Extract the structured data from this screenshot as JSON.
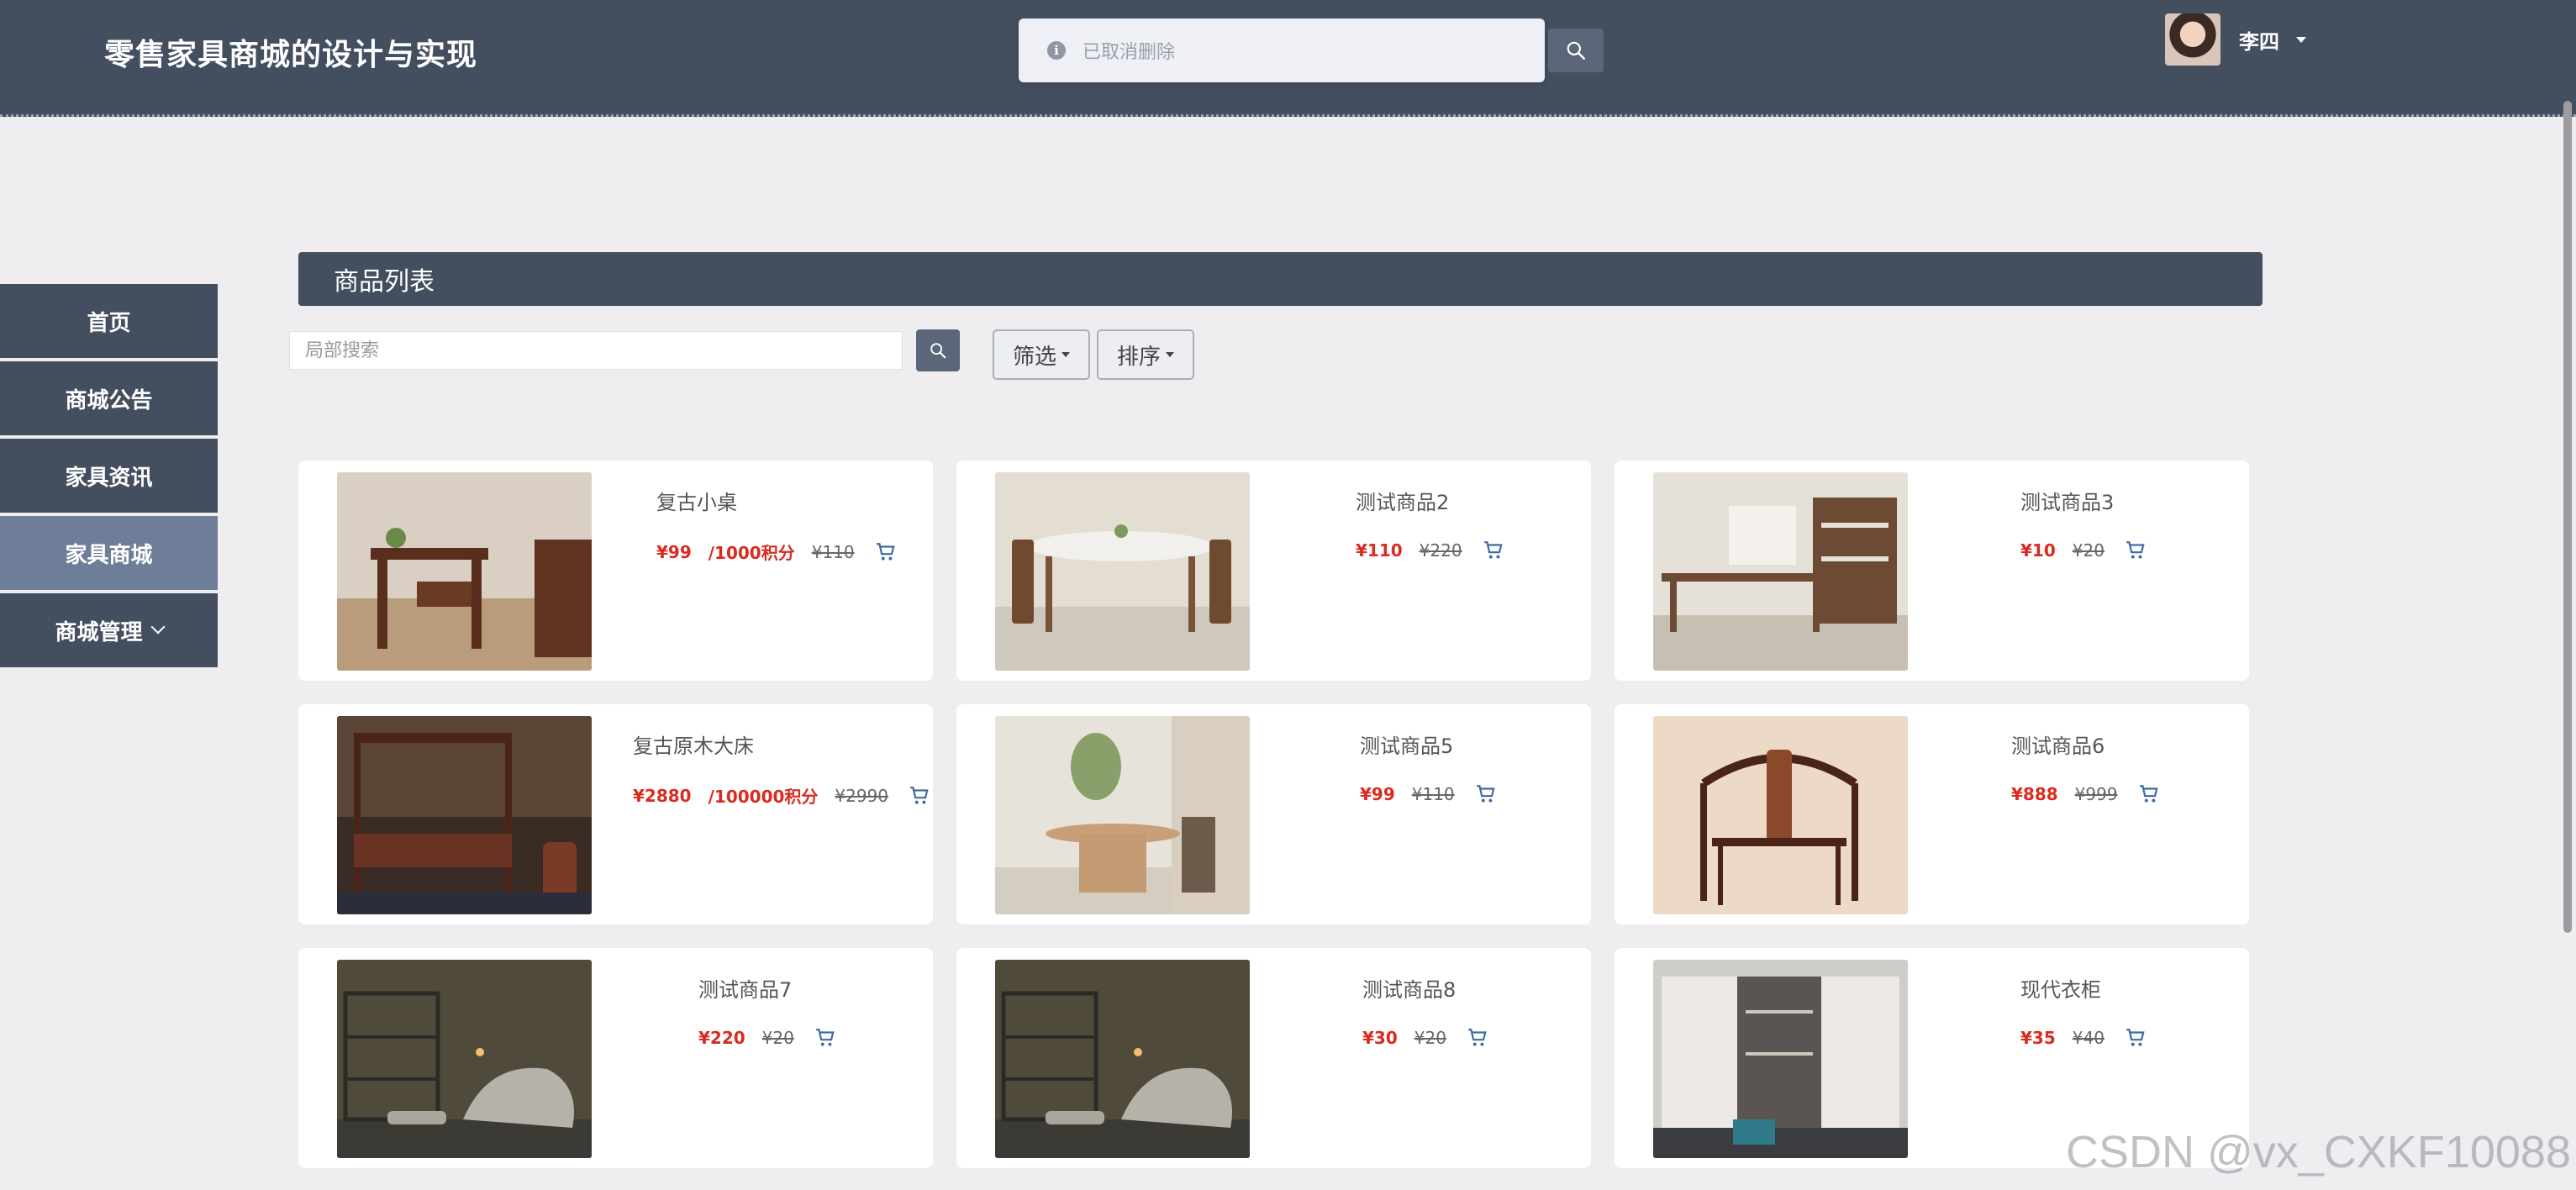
{
  "header": {
    "title": "零售家具商城的设计与实现",
    "toast_text": "已取消删除",
    "user_name": "李四"
  },
  "sidebar": {
    "items": [
      {
        "label": "首页"
      },
      {
        "label": "商城公告"
      },
      {
        "label": "家具资讯"
      },
      {
        "label": "家具商城",
        "active": true
      },
      {
        "label": "商城管理"
      }
    ]
  },
  "main": {
    "panel_title": "商品列表",
    "search_placeholder": "局部搜索",
    "filter_label": "筛选",
    "sort_label": "排序"
  },
  "products": [
    {
      "name": "复古小桌",
      "price": "¥99",
      "points": "/1000积分",
      "old_price": "¥110"
    },
    {
      "name": "测试商品2",
      "price": "¥110",
      "old_price": "¥220"
    },
    {
      "name": "测试商品3",
      "price": "¥10",
      "old_price": "¥20"
    },
    {
      "name": "复古原木大床",
      "price": "¥2880",
      "points": "/100000积分",
      "old_price": "¥2990"
    },
    {
      "name": "测试商品5",
      "price": "¥99",
      "old_price": "¥110"
    },
    {
      "name": "测试商品6",
      "price": "¥888",
      "old_price": "¥999"
    },
    {
      "name": "测试商品7",
      "price": "¥220",
      "old_price": "¥20"
    },
    {
      "name": "测试商品8",
      "price": "¥30",
      "old_price": "¥20"
    },
    {
      "name": "现代衣柜",
      "price": "¥35",
      "old_price": "¥40"
    }
  ],
  "watermark": "CSDN @vx_CXKF10088",
  "colors": {
    "header_bg": "#434e5f",
    "active_nav": "#6f7e98",
    "price_red": "#d92b20",
    "page_bg": "#efedf0"
  }
}
